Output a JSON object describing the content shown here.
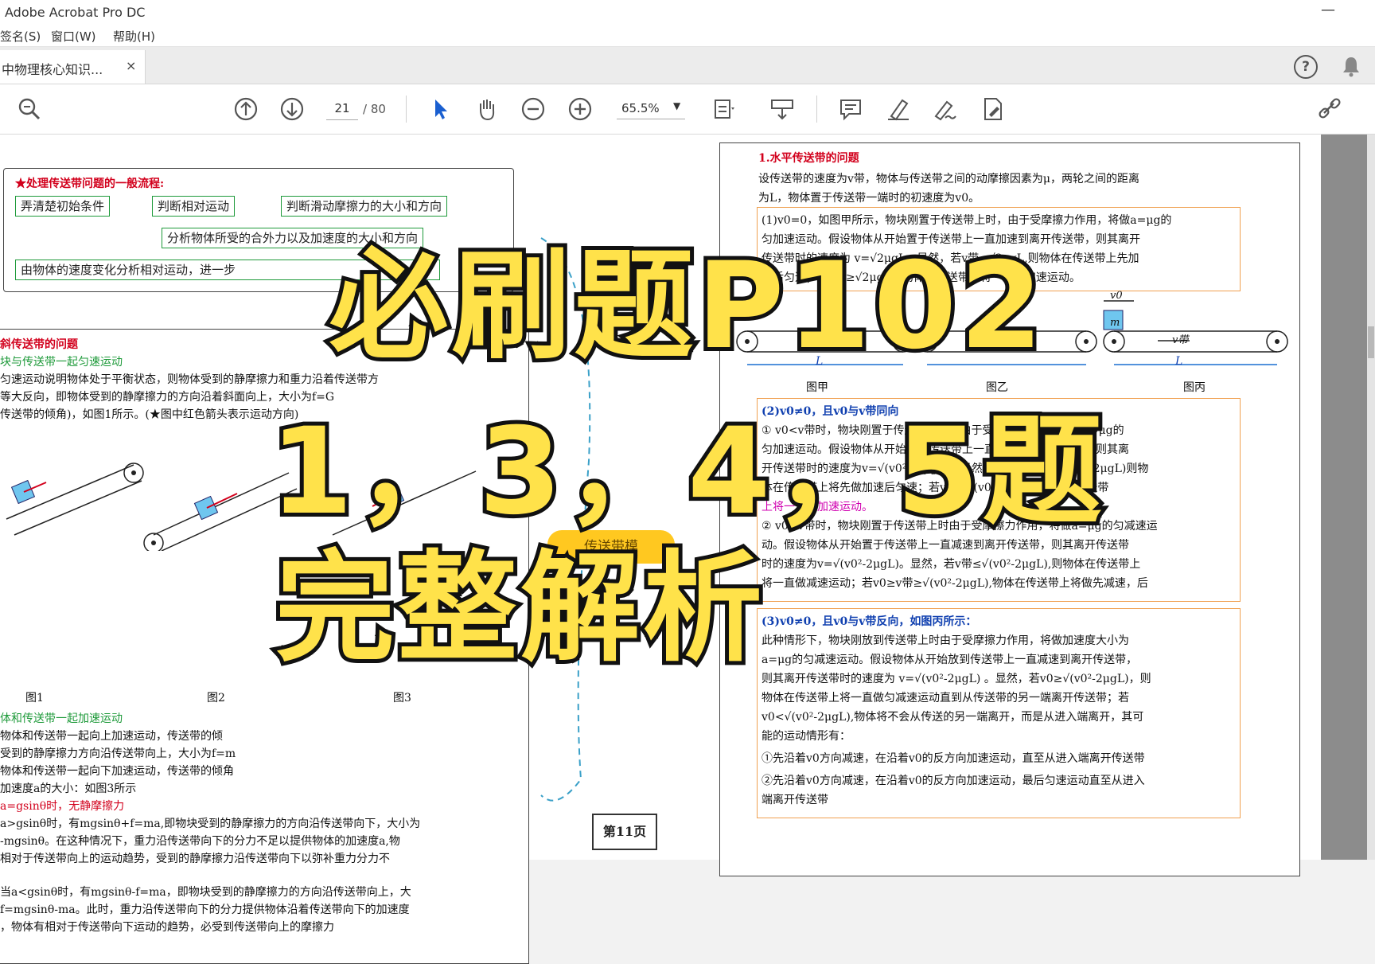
{
  "app": {
    "title": "Adobe Acrobat Pro DC"
  },
  "menu": {
    "items": [
      "签名(S)",
      "窗口(W)",
      "帮助(H)"
    ]
  },
  "tab": {
    "label": "中物理核心知识...",
    "close": "×"
  },
  "toolbar": {
    "page_current": "21",
    "page_total": "/ 80",
    "zoom": "65.5%"
  },
  "icons": [
    "search-icon",
    "page-up-icon",
    "page-down-icon",
    "select-cursor-icon",
    "hand-icon",
    "zoom-out-icon",
    "zoom-in-icon",
    "fit-page-icon",
    "scroll-mode-icon",
    "comment-icon",
    "highlight-icon",
    "sign-icon",
    "edit-pdf-icon",
    "share-link-icon",
    "help-icon",
    "bell-icon"
  ],
  "colors": {
    "overlay_fill": "#ffe24a",
    "overlay_stroke": "#111111",
    "accent_red": "#d2001c",
    "flow_green": "#1e9a3a"
  },
  "left_page": {
    "flow_title": "★处理传送带问题的一般流程:",
    "flow": {
      "step1": "弄清楚初始条件",
      "step2": "判断相对运动",
      "step3": "判断滑动摩擦力的大小和方向",
      "step4": "分析物体所受的合外力以及加速度的大小和方向",
      "step5": "由物体的速度变化分析相对运动，进一步"
    },
    "section_title": "斜传送带的问题",
    "sub1": "块与传送带一起匀速运动",
    "lines": [
      "匀速运动说明物体处于平衡状态，则物体受到的静摩擦力和重力沿着传送带方",
      "等大反向，即物体受到的静摩擦力的方向沿着斜面向上，大小为f=G",
      "传送带的倾角)，如图1所示。(★图中红色箭头表示运动方向)"
    ],
    "fig_labels": [
      "图1",
      "图2",
      "图3"
    ],
    "sub2": "体和传送带一起加速运动",
    "lines2": [
      "物体和传送带一起向上加速运动，传送带的倾",
      "受到的静摩擦力方向沿传送带向上，大小为f=m",
      "物体和传送带一起向下加速运动，传送带的倾角",
      "加速度a的大小：如图3所示",
      "a=gsinθ时，无静摩擦力",
      "a>gsinθ时，有mgsinθ+f=ma,即物块受到的静摩擦力的方向沿传送带向下，大小为",
      "-mgsinθ。在这种情况下，重力沿传送带向下的分力不足以提供物体的加速度a,物",
      "相对于传送带向上的运动趋势，受到的静摩擦力沿传送带向下以弥补重力分力不",
      "当a<gsinθ时，有mgsinθ-f=ma，即物块受到的静摩擦力的方向沿传送带向上，大",
      "f=mgsinθ-ma。此时，重力沿传送带向下的分力提供物体沿着传送带向下的加速度",
      "，物体有相对于传送带向下运动的趋势，必受到传送带向上的摩擦力"
    ]
  },
  "center_badge": "传送带模",
  "page_badge": "第11页",
  "right_page": {
    "section_title": "1.水平传送带的问题",
    "intro": [
      "设传送带的速度为v带，物体与传送带之间的动摩擦因素为μ，两轮之间的距离",
      "为L，物体置于传送带一端时的初速度为v0。"
    ],
    "case1": [
      "(1)v0=0，如图甲所示，物块刚置于传送带上时，由于受摩擦力作用，将做a=μg的",
      "匀加速运动。假设物体从开始置于传送带上一直加速到离开传送带，则其离开",
      "传送带时的速度为 v=√2μgL，显然，若v带<√2μgL,则物体在传送带上先加",
      "速后匀速；若v带≥√2μgL，物体在传送带上将一直做加速运动。"
    ],
    "fig_labels": [
      "图甲",
      "图乙",
      "图丙"
    ],
    "fig_symbols": {
      "length": "L",
      "v0": "v0",
      "mass": "m",
      "vbelt": "v带"
    },
    "case2": [
      "(2)v0≠0，且v0与v带同向",
      "① v0<v带时，物块刚置于传送带上时，由于受摩擦力作用，将做a=μg的",
      "匀加速运动。假设物体从开始置于传送带上一直加速到离开传送带，则其离",
      "开传送带时的速度为v=√(v0²+2μgL)，显然，若v0<v带<√(v0²+2μgL)则物",
      "体在传送带上将先做加速后匀速；若v带≥√(v0²+2μgL),物体在传送带",
      "上将一直做加速运动。",
      "② v0>v带时，物块刚置于传送带上时由于受摩擦力作用，将做a=μg的匀减速运",
      "动。假设物体从开始置于传送带上一直减速到离开传送带，则其离开传送带",
      "时的速度为v=√(v0²-2μgL)。显然，若v带≤√(v0²-2μgL),则物体在传送带上",
      "将一直做减速运动；若v0≥v带≥√(v0²-2μgL),物体在传送带上将做先减速，后"
    ],
    "case3": [
      "(3)v0≠0，且v0与v带反向，如图丙所示：",
      "此种情形下，物块刚放到传送带上时由于受摩擦力作用，将做加速度大小为",
      "a=μg的匀减速运动。假设物体从开始放到传送带上一直减速到离开传送带，",
      "则其离开传送带时的速度为 v=√(v0²-2μgL) 。显然，若v0≥√(v0²-2μgL)，则",
      "物体在传送带上将一直做匀减速运动直到从传送带的另一端离开传送带；若",
      "v0<√(v0²-2μgL),物体将不会从传送的另一端离开，而是从进入端离开，其可",
      "能的运动情形有：",
      "①先沿着v0方向减速，在沿着v0的反方向加速运动，直至从进入端离开传送带",
      "②先沿着v0方向减速，在沿着v0的反方向加速运动，最后匀速运动直至从进入",
      "端离开传送带"
    ]
  },
  "overlay": {
    "line1": "必刷题P102",
    "line2": "1，3，4，5题",
    "line3": "完整解析"
  }
}
